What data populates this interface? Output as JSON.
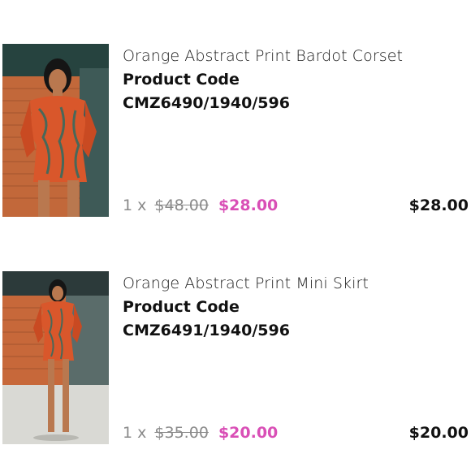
{
  "items": [
    {
      "name": "Orange Abstract Print Bardot Corset",
      "code_label": "Product Code",
      "code": "CMZ6490/1940/596",
      "qty": "1 x",
      "old_price": "$48.00",
      "new_price": "$28.00",
      "total": "$28.00",
      "image": "product-photo-model-corset"
    },
    {
      "name": "Orange Abstract Print Mini Skirt",
      "code_label": "Product Code",
      "code": "CMZ6491/1940/596",
      "qty": "1 x",
      "old_price": "$35.00",
      "new_price": "$20.00",
      "total": "$20.00",
      "image": "product-photo-model-skirt"
    }
  ],
  "colors": {
    "sale_price": "#d94fb6",
    "muted": "#8a8a8a",
    "text": "#111111"
  }
}
